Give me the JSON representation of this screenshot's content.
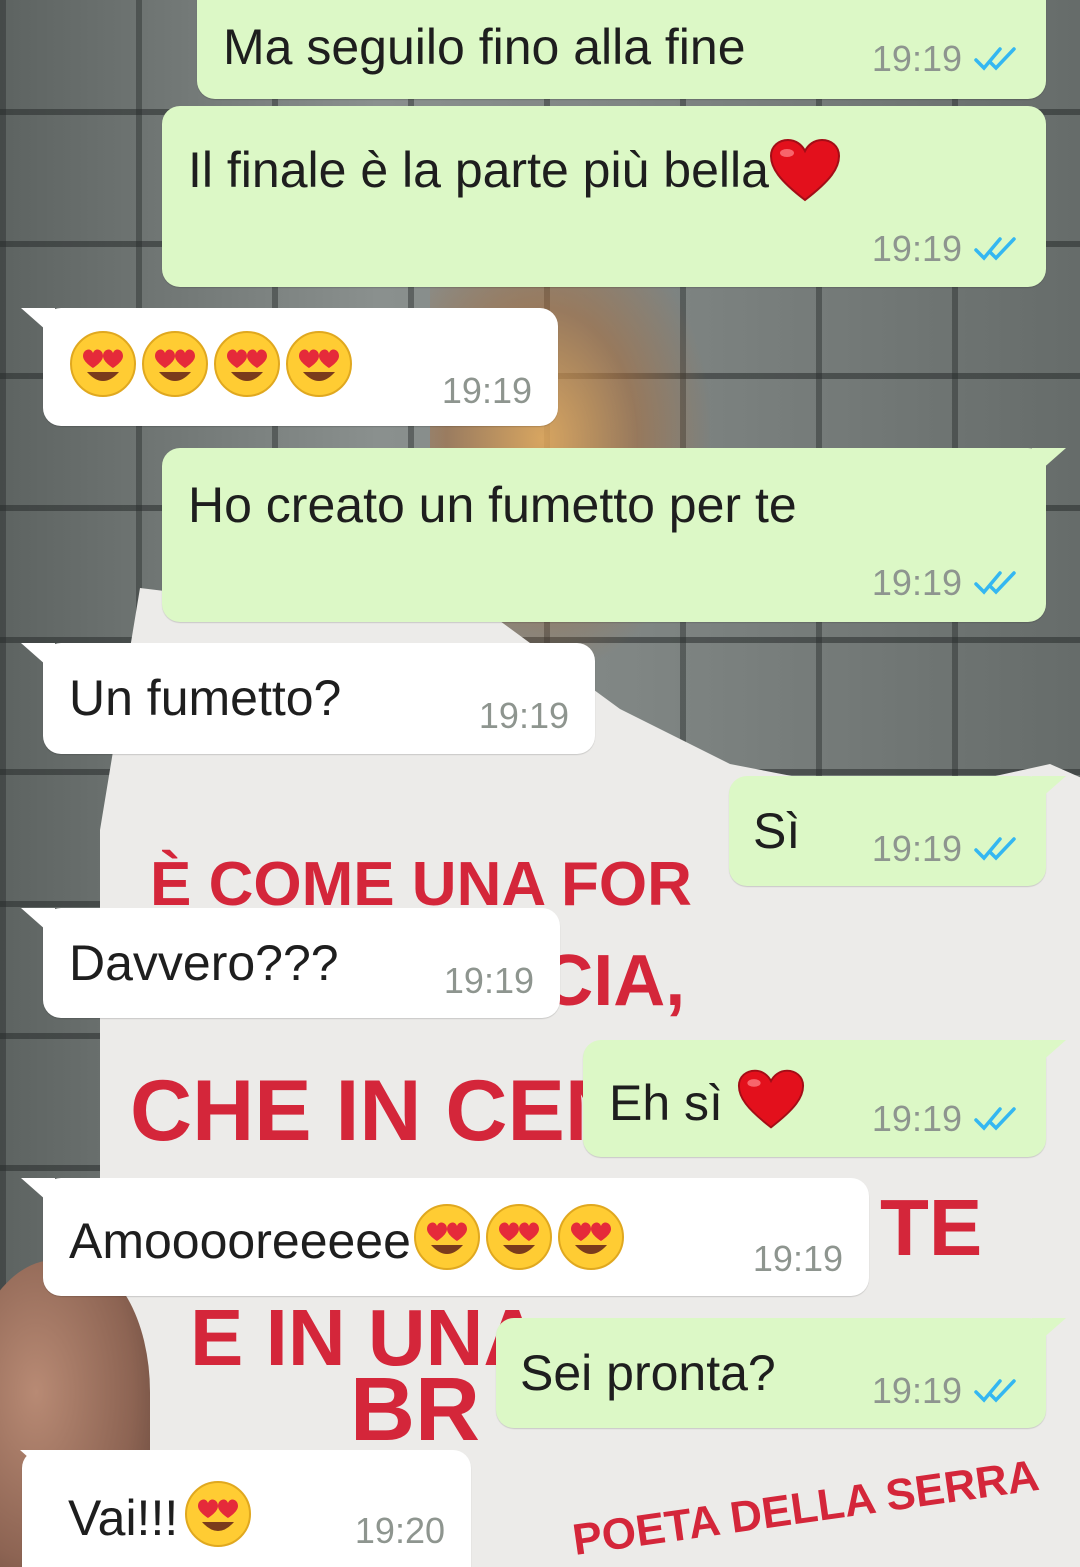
{
  "icons": {
    "read_receipt": "double-check-icon",
    "heart": "red-heart-emoji",
    "heart_eyes": "smiling-face-with-heart-eyes-emoji"
  },
  "colors": {
    "outgoing_bubble": "#dcf8c6",
    "incoming_bubble": "#ffffff",
    "read_tick": "#34b7f1",
    "timestamp": "#8e958f"
  },
  "background_note": {
    "line1": "È COME UNA FOR",
    "line2": "LA FIDUCIA,",
    "line3": "CHE IN CEN",
    "line4": "TE",
    "line5": "E IN UNA",
    "line6": "BR",
    "signature": "POETA DELLA SERRA"
  },
  "messages": [
    {
      "direction": "out",
      "text": "Ma seguilo fino alla fine",
      "time": "19:19",
      "read": true
    },
    {
      "direction": "out",
      "text": "Il finale è la parte più bella",
      "emoji_after": "heart",
      "time": "19:19",
      "read": true
    },
    {
      "direction": "in",
      "text": "",
      "emojis": [
        "heart_eyes",
        "heart_eyes",
        "heart_eyes",
        "heart_eyes"
      ],
      "time": "19:19"
    },
    {
      "direction": "out",
      "text": "Ho creato un fumetto per te",
      "time": "19:19",
      "read": true
    },
    {
      "direction": "in",
      "text": "Un fumetto?",
      "time": "19:19"
    },
    {
      "direction": "out",
      "text": "Sì",
      "time": "19:19",
      "read": true
    },
    {
      "direction": "in",
      "text": "Davvero???",
      "time": "19:19"
    },
    {
      "direction": "out",
      "text": "Eh sì ",
      "emoji_after": "heart",
      "time": "19:19",
      "read": true
    },
    {
      "direction": "in",
      "text": "Amooooreeeee",
      "emojis": [
        "heart_eyes",
        "heart_eyes",
        "heart_eyes"
      ],
      "time": "19:19"
    },
    {
      "direction": "out",
      "text": "Sei pronta?",
      "time": "19:19",
      "read": true
    },
    {
      "direction": "in",
      "text": "Vai!!! ",
      "emojis": [
        "heart_eyes"
      ],
      "time": "19:20"
    }
  ]
}
